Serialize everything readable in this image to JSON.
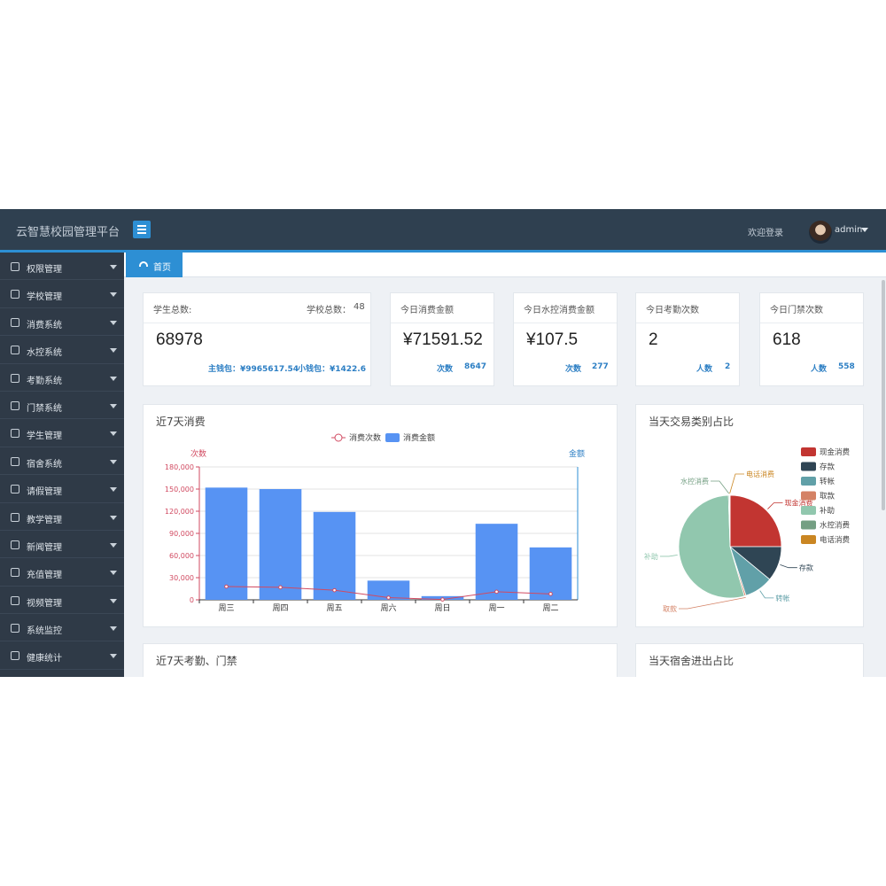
{
  "header": {
    "brand": "云智慧校园管理平台",
    "welcome": "欢迎登录",
    "username": "admin"
  },
  "sidebar": {
    "items": [
      {
        "label": "权限管理",
        "icon": "gear-icon"
      },
      {
        "label": "学校管理",
        "icon": "book-icon"
      },
      {
        "label": "消费系统",
        "icon": "receipt-icon"
      },
      {
        "label": "水控系统",
        "icon": "water-icon"
      },
      {
        "label": "考勤系统",
        "icon": "attendance-icon"
      },
      {
        "label": "门禁系统",
        "icon": "door-icon"
      },
      {
        "label": "学生管理",
        "icon": "users-icon"
      },
      {
        "label": "宿舍系统",
        "icon": "building-icon"
      },
      {
        "label": "请假管理",
        "icon": "calendar-icon"
      },
      {
        "label": "教学管理",
        "icon": "teaching-icon"
      },
      {
        "label": "新闻管理",
        "icon": "news-icon"
      },
      {
        "label": "充值管理",
        "icon": "recharge-icon"
      },
      {
        "label": "视频管理",
        "icon": "video-icon"
      },
      {
        "label": "系统监控",
        "icon": "monitor-icon"
      },
      {
        "label": "健康统计",
        "icon": "health-icon"
      }
    ]
  },
  "tabs": [
    {
      "label": "首页",
      "icon": "dashboard-icon"
    }
  ],
  "stats": {
    "students": {
      "title": "学生总数:",
      "value": "68978",
      "schools_label": "学校总数：",
      "schools_value": "48",
      "main_wallet": "主钱包：¥9965617.54",
      "small_wallet": "小钱包：¥1422.6"
    },
    "consume": {
      "title": "今日消费金额",
      "value": "¥71591.52",
      "count_label": "次数",
      "count": "8647"
    },
    "water": {
      "title": "今日水控消费金额",
      "value": "¥107.5",
      "count_label": "次数",
      "count": "277"
    },
    "attendance": {
      "title": "今日考勤次数",
      "value": "2",
      "people_label": "人数",
      "people": "2"
    },
    "gate": {
      "title": "今日门禁次数",
      "value": "618",
      "people_label": "人数",
      "people": "558"
    }
  },
  "panels": {
    "consume7": "近7天消费",
    "pie": "当天交易类别占比",
    "bottom_left": "近7天考勤、门禁",
    "bottom_right": "当天宿舍进出占比"
  },
  "colors": {
    "accent": "#2d8fd4",
    "bar": "#5793f3",
    "line": "#d14a61"
  },
  "chart_data": [
    {
      "type": "bar",
      "title": "近7天消费",
      "categories": [
        "周三",
        "周四",
        "周五",
        "周六",
        "周日",
        "周一",
        "周二"
      ],
      "legend": [
        "消费次数",
        "消费金额"
      ],
      "left_axis_label": "次数",
      "right_axis_label": "金额",
      "ylim": [
        0,
        180000
      ],
      "yticks": [
        0,
        30000,
        60000,
        90000,
        120000,
        150000,
        180000
      ],
      "ytick_labels": [
        "0",
        "30,000",
        "60,000",
        "90,000",
        "120,000",
        "150,000",
        "180,000"
      ],
      "series": [
        {
          "name": "消费金额",
          "kind": "bar",
          "values": [
            152000,
            150000,
            119000,
            26000,
            5000,
            103000,
            71000
          ]
        },
        {
          "name": "消费次数",
          "kind": "line",
          "values": [
            18000,
            17000,
            13000,
            3000,
            500,
            11000,
            8000
          ]
        }
      ]
    },
    {
      "type": "pie",
      "title": "当天交易类别占比",
      "legend_position": "right",
      "slices": [
        {
          "name": "现金消费",
          "value": 25,
          "color": "#c23531"
        },
        {
          "name": "存款",
          "value": 11,
          "color": "#2f4554"
        },
        {
          "name": "转帐",
          "value": 9,
          "color": "#61a0a8"
        },
        {
          "name": "取款",
          "value": 0.5,
          "color": "#d48265"
        },
        {
          "name": "补助",
          "value": 54,
          "color": "#91c7ae"
        },
        {
          "name": "水控消费",
          "value": 0.3,
          "color": "#749f83"
        },
        {
          "name": "电话消费",
          "value": 0.2,
          "color": "#ca8622"
        }
      ]
    }
  ]
}
